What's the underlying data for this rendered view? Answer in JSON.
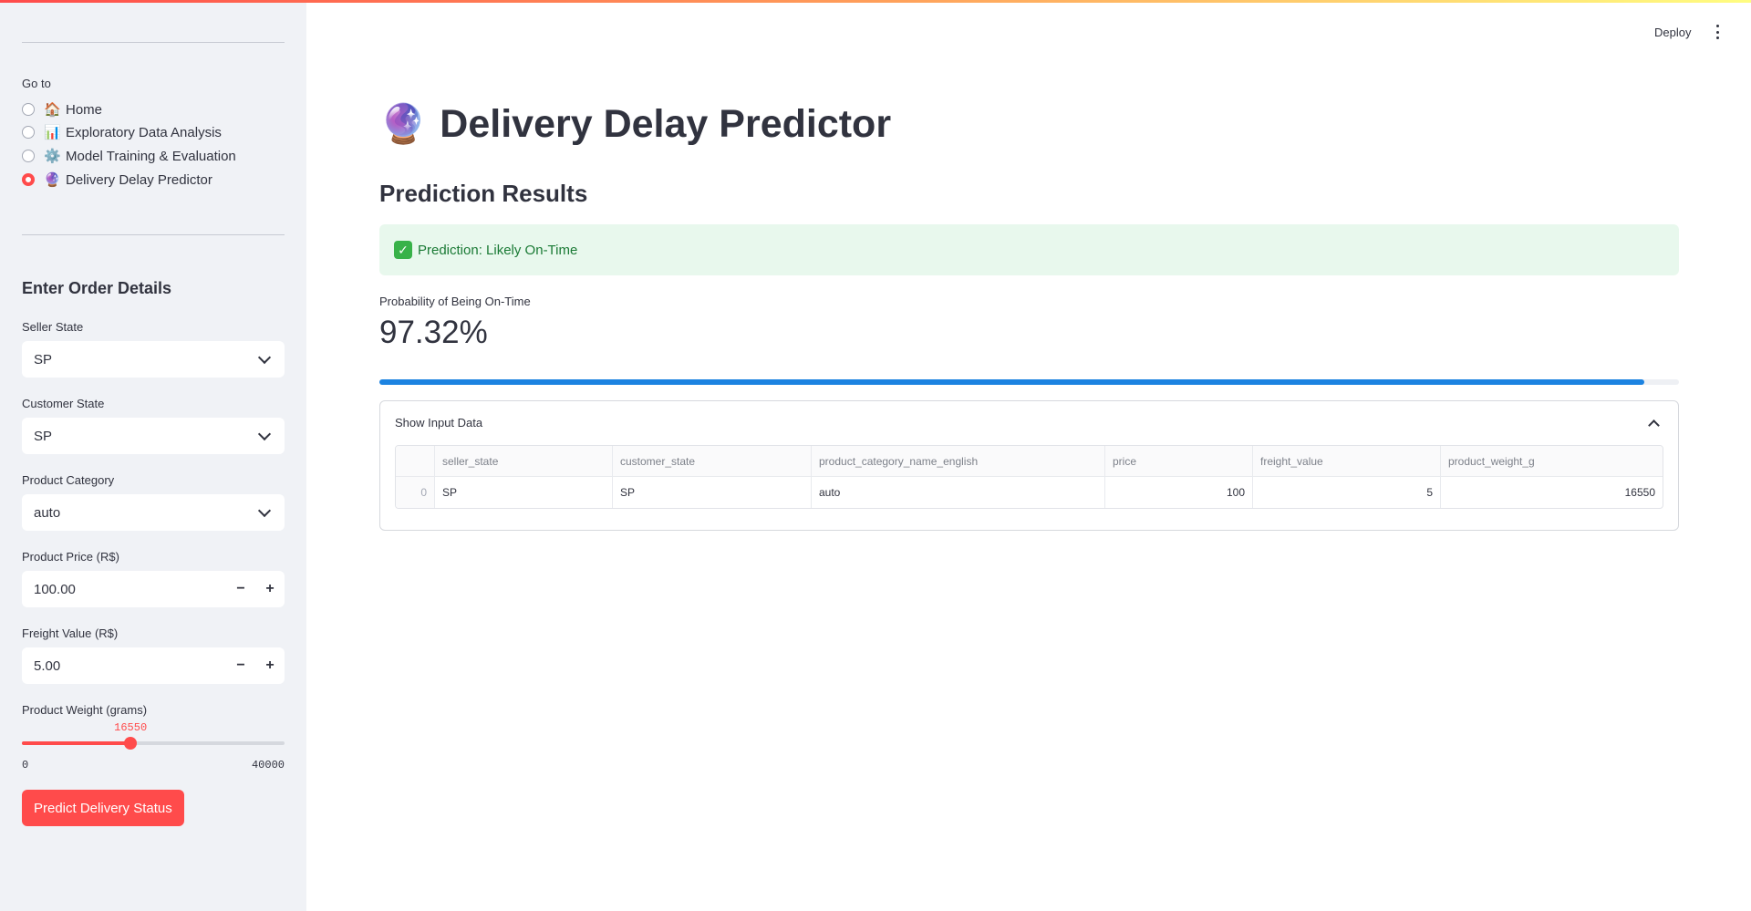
{
  "header": {
    "deploy_label": "Deploy"
  },
  "sidebar": {
    "nav_label": "Go to",
    "nav_items": [
      {
        "emoji": "🏠",
        "label": "Home",
        "selected": false
      },
      {
        "emoji": "📊",
        "label": "Exploratory Data Analysis",
        "selected": false
      },
      {
        "emoji": "⚙️",
        "label": "Model Training & Evaluation",
        "selected": false
      },
      {
        "emoji": "🔮",
        "label": "Delivery Delay Predictor",
        "selected": true
      }
    ],
    "form_title": "Enter Order Details",
    "seller_state": {
      "label": "Seller State",
      "value": "SP"
    },
    "customer_state": {
      "label": "Customer State",
      "value": "SP"
    },
    "product_category": {
      "label": "Product Category",
      "value": "auto"
    },
    "product_price": {
      "label": "Product Price (R$)",
      "value": "100.00",
      "minus": "−",
      "plus": "+"
    },
    "freight_value": {
      "label": "Freight Value (R$)",
      "value": "5.00",
      "minus": "−",
      "plus": "+"
    },
    "product_weight": {
      "label": "Product Weight (grams)",
      "value": "16550",
      "min": "0",
      "max": "40000",
      "fraction": 0.41375
    },
    "predict_button": "Predict Delivery Status"
  },
  "main": {
    "title_emoji": "🔮",
    "title": "Delivery Delay Predictor",
    "subtitle": "Prediction Results",
    "success_icon": "✓",
    "success_text": "Prediction: Likely On-Time",
    "metric_label": "Probability of Being On-Time",
    "metric_value": "97.32%",
    "progress_fraction": 0.9732,
    "expander_label": "Show Input Data",
    "table": {
      "columns": [
        "",
        "seller_state",
        "customer_state",
        "product_category_name_english",
        "price",
        "freight_value",
        "product_weight_g"
      ],
      "rows": [
        [
          "0",
          "SP",
          "SP",
          "auto",
          "100",
          "5",
          "16550"
        ]
      ]
    }
  },
  "colors": {
    "accent": "#ff4b4b",
    "progress": "#1c83e1",
    "success_bg": "#e8f8ed",
    "success_text": "#1a7a35",
    "sidebar_bg": "#f0f2f6"
  }
}
